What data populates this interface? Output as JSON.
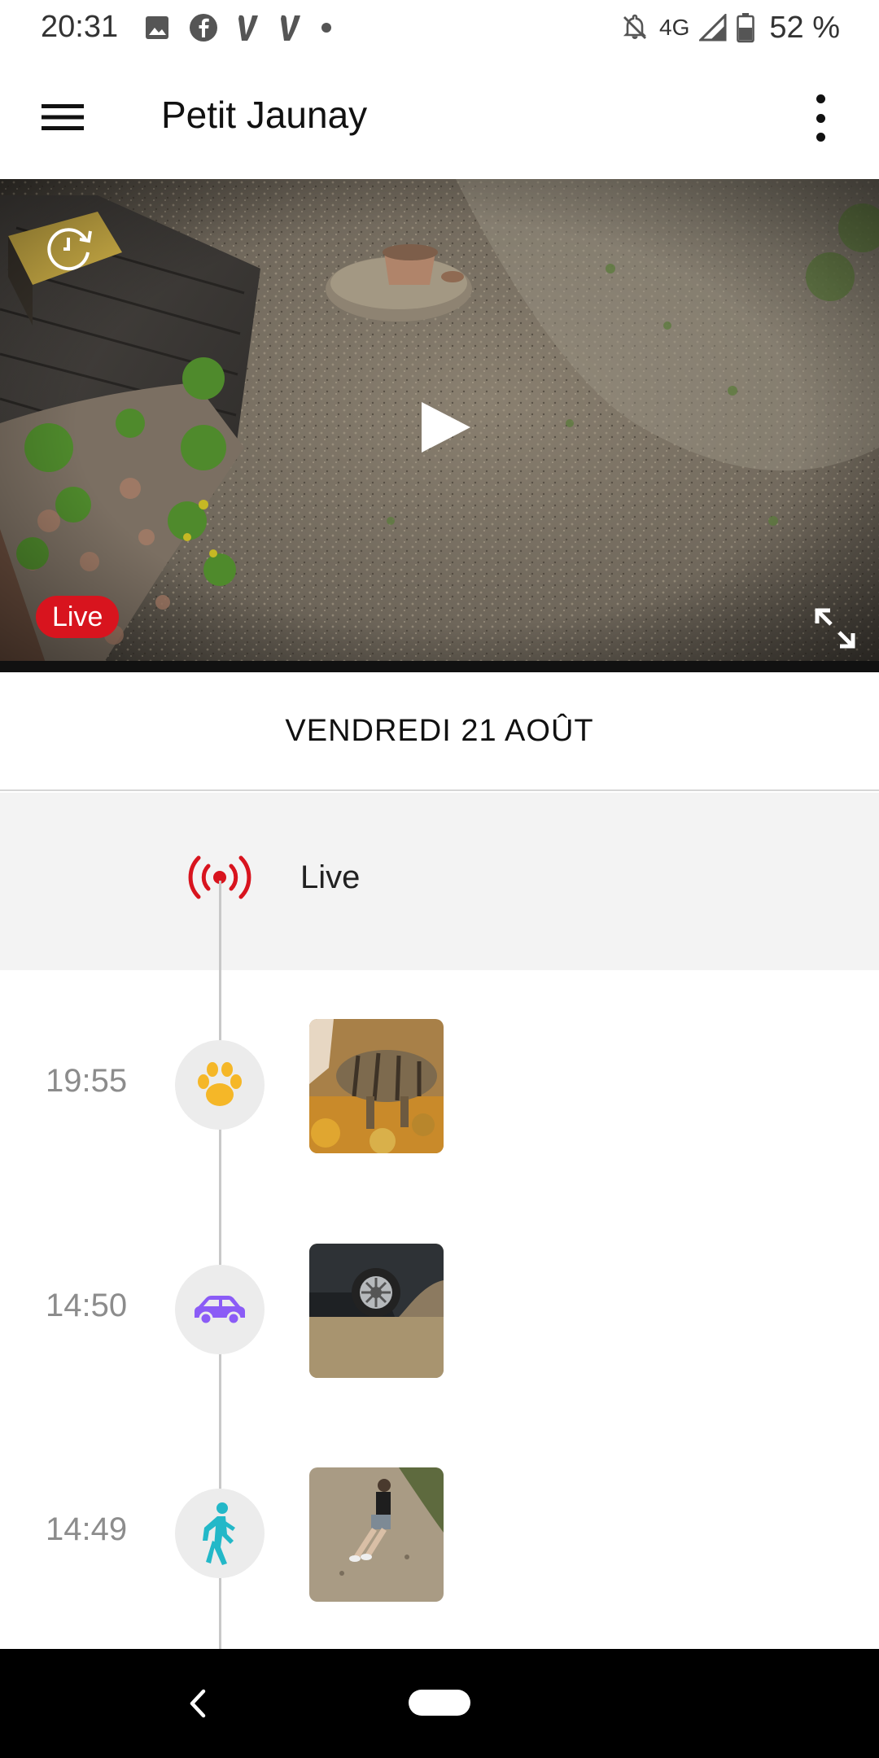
{
  "status_bar": {
    "time": "20:31",
    "left_icons": [
      "image-icon",
      "facebook-icon",
      "vinted-icon",
      "vinted-icon",
      "dot-icon"
    ],
    "network": "4G",
    "battery_percent": "52 %",
    "right_icons": [
      "notifications-off-icon",
      "signal-icon",
      "battery-icon"
    ]
  },
  "appbar": {
    "title": "Petit Jaunay",
    "menu_icon": "hamburger-menu-icon",
    "more_icon": "more-vertical-icon"
  },
  "camera": {
    "live_badge": "Live",
    "replay_icon": "replay-icon",
    "play_icon": "play-icon",
    "fullscreen_icon": "fullscreen-icon",
    "live_color": "#d8141e"
  },
  "timeline": {
    "date": "VENDREDI 21 AOÛT",
    "live_label": "Live",
    "events": [
      {
        "time": "19:55",
        "type": "animal",
        "icon": "paw-icon",
        "color": "#f5b728"
      },
      {
        "time": "14:50",
        "type": "vehicle",
        "icon": "car-icon",
        "color": "#8b5cf6"
      },
      {
        "time": "14:49",
        "type": "person",
        "icon": "walking-person-icon",
        "color": "#23b8c8"
      }
    ]
  },
  "navbar": {
    "back_icon": "back-chevron-icon",
    "home_icon": "home-pill-icon"
  }
}
